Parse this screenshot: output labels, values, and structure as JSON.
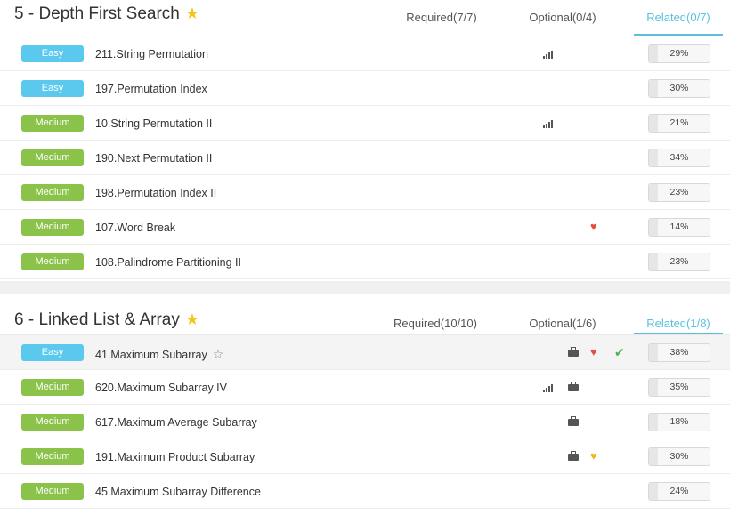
{
  "sections": [
    {
      "title": "5 - Depth First Search",
      "tabs": [
        "Required(7/7)",
        "Optional(0/4)",
        "Related(0/7)"
      ],
      "problems": [
        {
          "difficulty": "Easy",
          "name": "211.String Permutation",
          "percent": "29%"
        },
        {
          "difficulty": "Easy",
          "name": "197.Permutation Index",
          "percent": "30%"
        },
        {
          "difficulty": "Medium",
          "name": "10.String Permutation II",
          "percent": "21%"
        },
        {
          "difficulty": "Medium",
          "name": "190.Next Permutation II",
          "percent": "34%"
        },
        {
          "difficulty": "Medium",
          "name": "198.Permutation Index II",
          "percent": "23%"
        },
        {
          "difficulty": "Medium",
          "name": "107.Word Break",
          "percent": "14%"
        },
        {
          "difficulty": "Medium",
          "name": "108.Palindrome Partitioning II",
          "percent": "23%"
        }
      ]
    },
    {
      "title": "6 - Linked List & Array",
      "tabs": [
        "Required(10/10)",
        "Optional(1/6)",
        "Related(1/8)"
      ],
      "problems": [
        {
          "difficulty": "Easy",
          "name": "41.Maximum Subarray",
          "percent": "38%"
        },
        {
          "difficulty": "Medium",
          "name": "620.Maximum Subarray IV",
          "percent": "35%"
        },
        {
          "difficulty": "Medium",
          "name": "617.Maximum Average Subarray",
          "percent": "18%"
        },
        {
          "difficulty": "Medium",
          "name": "191.Maximum Product Subarray",
          "percent": "30%"
        },
        {
          "difficulty": "Medium",
          "name": "45.Maximum Subarray Difference",
          "percent": "24%"
        }
      ]
    }
  ],
  "icons": {
    "title_star": "star-icon",
    "favorite": "star-outline-icon",
    "signal": "signal-bars-icon",
    "company": "briefcase-icon",
    "hot": "flame-icon",
    "solved": "checkmark-icon"
  },
  "colors": {
    "easy": "#5bc8ee",
    "medium": "#8bc34a",
    "accent": "#5bc0de",
    "hot_red": "#e74c3c",
    "hot_orange": "#f0b429",
    "solved": "#4caf50"
  }
}
